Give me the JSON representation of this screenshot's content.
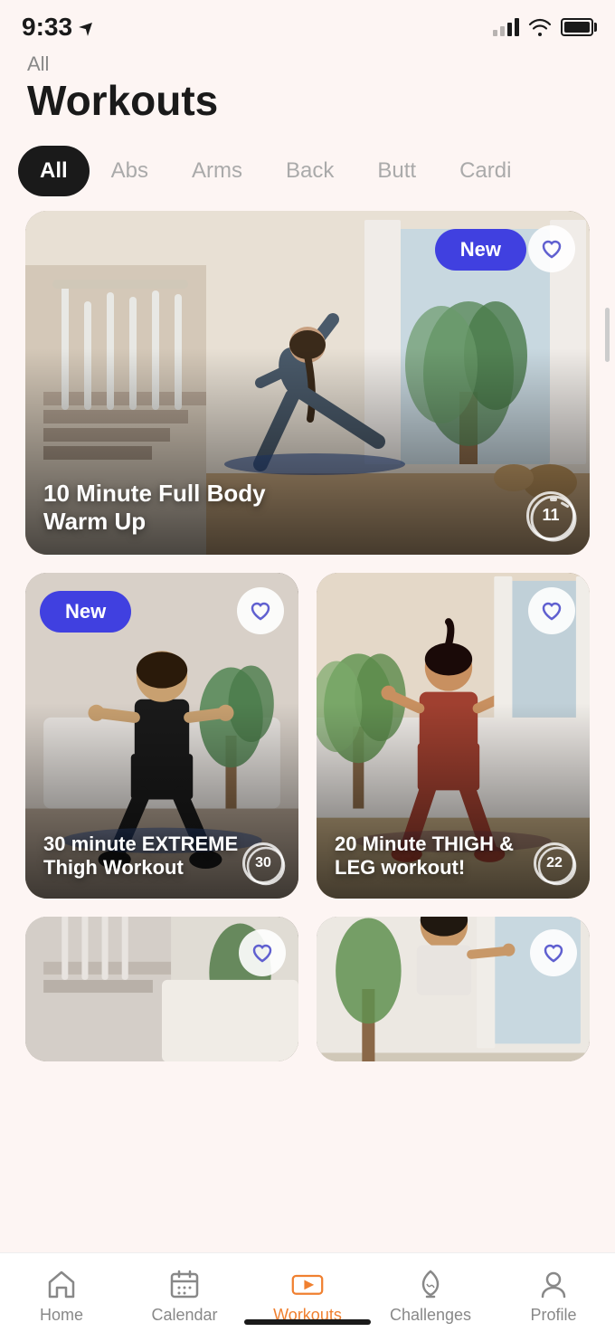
{
  "statusBar": {
    "time": "9:33",
    "navigationArrow": "↗"
  },
  "header": {
    "breadcrumb": "All",
    "title": "Workouts"
  },
  "filters": {
    "tabs": [
      {
        "id": "all",
        "label": "All",
        "active": true
      },
      {
        "id": "abs",
        "label": "Abs",
        "active": false
      },
      {
        "id": "arms",
        "label": "Arms",
        "active": false
      },
      {
        "id": "back",
        "label": "Back",
        "active": false
      },
      {
        "id": "butt",
        "label": "Butt",
        "active": false
      },
      {
        "id": "cardio",
        "label": "Cardi...",
        "active": false
      }
    ]
  },
  "workouts": [
    {
      "id": 1,
      "title": "10 Minute Full Body\nWarm Up",
      "badge": "New",
      "badgePosition": "top-right",
      "duration": "11",
      "size": "large",
      "liked": false
    },
    {
      "id": 2,
      "title": "30 minute EXTREME Thigh Workout",
      "badge": "New",
      "badgePosition": "top-left",
      "duration": "30",
      "size": "small",
      "liked": false
    },
    {
      "id": 3,
      "title": "20 Minute THIGH & LEG workout!",
      "badge": null,
      "duration": "22",
      "size": "small",
      "liked": false
    },
    {
      "id": 4,
      "title": "",
      "badge": null,
      "duration": null,
      "size": "partial",
      "liked": false
    },
    {
      "id": 5,
      "title": "",
      "badge": null,
      "duration": null,
      "size": "partial",
      "liked": false
    }
  ],
  "bottomNav": {
    "items": [
      {
        "id": "home",
        "label": "Home",
        "active": false,
        "icon": "home-icon"
      },
      {
        "id": "calendar",
        "label": "Calendar",
        "active": false,
        "icon": "calendar-icon"
      },
      {
        "id": "workouts",
        "label": "Workouts",
        "active": true,
        "icon": "workouts-icon"
      },
      {
        "id": "challenges",
        "label": "Challenges",
        "active": false,
        "icon": "challenges-icon"
      },
      {
        "id": "profile",
        "label": "Profile",
        "active": false,
        "icon": "profile-icon"
      }
    ]
  }
}
